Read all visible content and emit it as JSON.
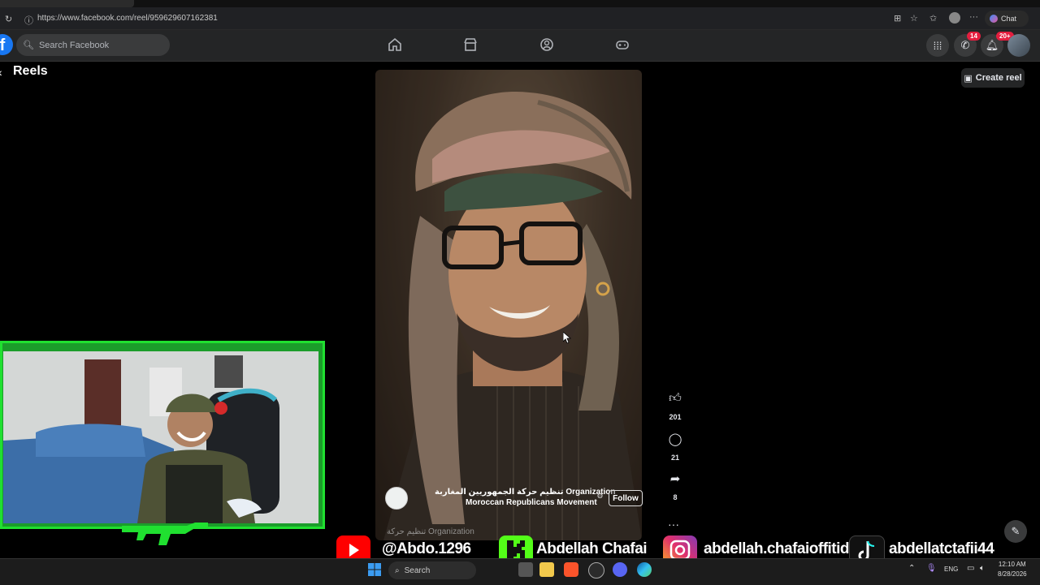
{
  "browser": {
    "url": "https://www.facebook.com/reel/959629607162381",
    "chat_label": "Chat"
  },
  "facebook": {
    "search_placeholder": "Search Facebook",
    "messenger_badge": "14",
    "notifications_badge": "20+",
    "section_title": "Reels",
    "create_reel_label": "Create reel"
  },
  "reel": {
    "page_name_ar": "تنظيم حركة الجمهوريين المغاربة Organization",
    "page_name_en": "Moroccan Republicans Movement",
    "follow_label": "Follow",
    "caption_ghost": "تنظيم حركة Organization",
    "likes": "201",
    "comments": "21",
    "shares": "8"
  },
  "overlay": {
    "youtube_handle": "@Abdo.1296",
    "kick_name": "Abdellah Chafai",
    "instagram_handle": "abdellah.chafaioffitid",
    "tiktok_handle": "abdellatctafii44"
  },
  "taskbar": {
    "search_label": "Search",
    "language": "ENG",
    "time": "12:10 AM",
    "date": "8/28/2026"
  },
  "colors": {
    "fb_blue": "#1877f2",
    "webcam_frame": "#20e030",
    "badge_red": "#e41e3f"
  }
}
